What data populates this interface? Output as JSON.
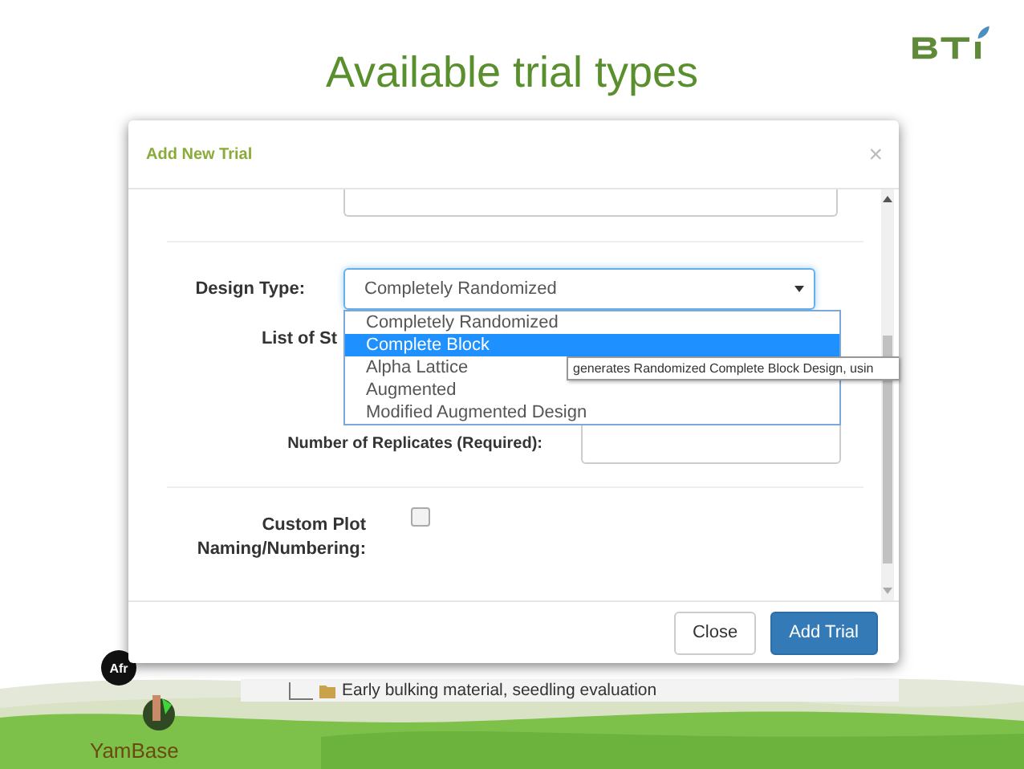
{
  "slide": {
    "title": "Available trial types",
    "footer_label": "YamBase",
    "partner_badge": "Afr"
  },
  "dialog": {
    "title": "Add New Trial",
    "close_glyph": "×",
    "design_type": {
      "label": "Design Type:",
      "value": "Completely Randomized",
      "expanded": true,
      "options": [
        {
          "label": "Completely Randomized",
          "highlighted": false
        },
        {
          "label": "Complete Block",
          "highlighted": true
        },
        {
          "label": "Alpha Lattice",
          "highlighted": false
        },
        {
          "label": "Augmented",
          "highlighted": false
        },
        {
          "label": "Modified Augmented Design",
          "highlighted": false
        }
      ]
    },
    "hidden_label": "List of St",
    "tooltip": "generates Randomized Complete Block Design, usin",
    "replicates": {
      "label": "Number of Replicates (Required):"
    },
    "custom_plot": {
      "label_lines": [
        "Custom Plot",
        "Naming/Numbering:"
      ],
      "checked": false
    },
    "buttons": [
      {
        "label": "Close",
        "kind": "default"
      },
      {
        "label": "Add Trial",
        "kind": "primary"
      }
    ]
  },
  "background_row": {
    "text": "Early bulking material, seedling evaluation"
  }
}
